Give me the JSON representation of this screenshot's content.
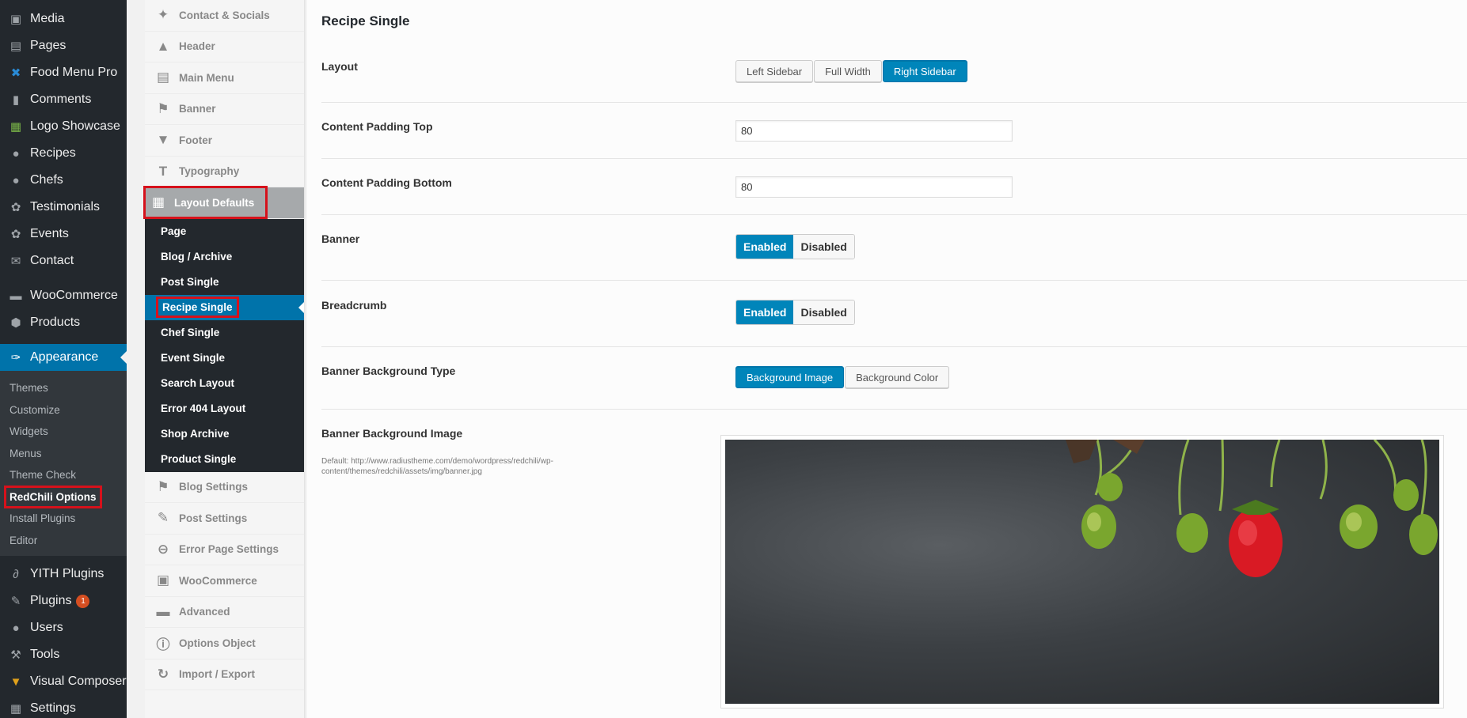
{
  "wp_menu": {
    "items": [
      {
        "label": "Media",
        "icon": "media-icon"
      },
      {
        "label": "Pages",
        "icon": "pages-icon"
      },
      {
        "label": "Food Menu Pro",
        "icon": "food-menu-icon"
      },
      {
        "label": "Comments",
        "icon": "comments-icon"
      },
      {
        "label": "Logo Showcase",
        "icon": "logo-showcase-icon"
      },
      {
        "label": "Recipes",
        "icon": "recipes-icon"
      },
      {
        "label": "Chefs",
        "icon": "chefs-icon"
      },
      {
        "label": "Testimonials",
        "icon": "testimonials-icon"
      },
      {
        "label": "Events",
        "icon": "events-icon"
      },
      {
        "label": "Contact",
        "icon": "contact-icon"
      },
      {
        "label": "WooCommerce",
        "icon": "woocommerce-icon"
      },
      {
        "label": "Products",
        "icon": "products-icon"
      },
      {
        "label": "Appearance",
        "icon": "appearance-icon"
      }
    ],
    "appearance_sub": [
      "Themes",
      "Customize",
      "Widgets",
      "Menus",
      "Theme Check",
      "RedChili Options",
      "Install Plugins",
      "Editor"
    ],
    "bottom_items": [
      {
        "label": "YITH Plugins",
        "icon": "yith-icon"
      },
      {
        "label": "Plugins",
        "icon": "plugins-icon",
        "badge": "1"
      },
      {
        "label": "Users",
        "icon": "users-icon"
      },
      {
        "label": "Tools",
        "icon": "tools-icon"
      },
      {
        "label": "Visual Composer",
        "icon": "visual-composer-icon"
      },
      {
        "label": "Settings",
        "icon": "settings-icon"
      }
    ],
    "accent": "#0073aa"
  },
  "options_menu": {
    "top_items": [
      "Contact & Socials",
      "Header",
      "Main Menu",
      "Banner",
      "Footer",
      "Typography"
    ],
    "section": "Layout Defaults",
    "section_sub": [
      "Page",
      "Blog / Archive",
      "Post Single",
      "Recipe Single",
      "Chef Single",
      "Event Single",
      "Search Layout",
      "Error 404 Layout",
      "Shop Archive",
      "Product Single"
    ],
    "bottom_items": [
      "Blog Settings",
      "Post Settings",
      "Error Page Settings",
      "WooCommerce",
      "Advanced",
      "Options Object",
      "Import / Export"
    ],
    "highlight": "#d6111b"
  },
  "main": {
    "title": "Recipe Single",
    "layout": {
      "label": "Layout",
      "options": [
        "Left Sidebar",
        "Full Width",
        "Right Sidebar"
      ],
      "selected": "Right Sidebar"
    },
    "padding_top": {
      "label": "Content Padding Top",
      "value": "80"
    },
    "padding_bottom": {
      "label": "Content Padding Bottom",
      "value": "80"
    },
    "banner": {
      "label": "Banner",
      "on": "Enabled",
      "off": "Disabled",
      "selected": "Enabled"
    },
    "breadcrumb": {
      "label": "Breadcrumb",
      "on": "Enabled",
      "off": "Disabled",
      "selected": "Enabled"
    },
    "banner_bg_type": {
      "label": "Banner Background Type",
      "options": [
        "Background Image",
        "Background Color"
      ],
      "selected": "Background Image"
    },
    "banner_bg_image": {
      "label": "Banner Background Image",
      "description": "Default: http://www.radiustheme.com/demo/wordpress/redchili/wp-content/themes/redchili/assets/img/banner.jpg"
    }
  }
}
